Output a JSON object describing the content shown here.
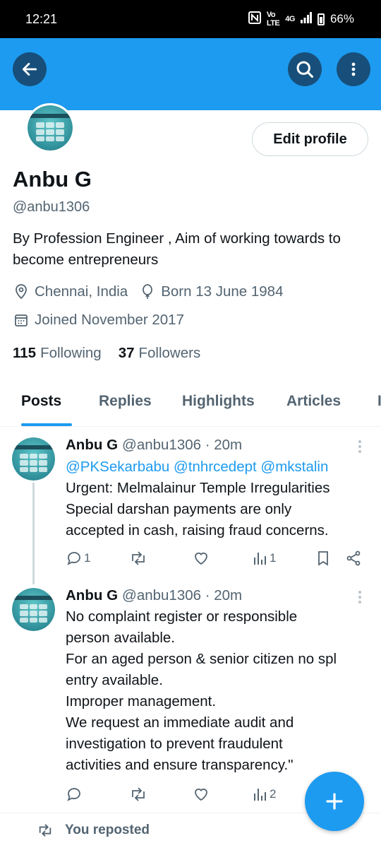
{
  "status_bar": {
    "time": "12:21",
    "network": "4G",
    "battery": "66%"
  },
  "header": {
    "back_icon": "arrow-left-icon",
    "search_icon": "search-icon",
    "more_icon": "more-vertical-icon",
    "banner_color": "#1d9bf0"
  },
  "profile": {
    "edit_button": "Edit profile",
    "name": "Anbu G",
    "handle": "@anbu1306",
    "bio": "By Profession Engineer , Aim of working towards to become entrepreneurs",
    "location": "Chennai, India",
    "birthday": "Born 13 June 1984",
    "joined": "Joined November 2017",
    "following_count": "115",
    "following_label": "Following",
    "followers_count": "37",
    "followers_label": "Followers"
  },
  "tabs": [
    {
      "label": "Posts",
      "active": true
    },
    {
      "label": "Replies",
      "active": false
    },
    {
      "label": "Highlights",
      "active": false
    },
    {
      "label": "Articles",
      "active": false
    },
    {
      "label": "I",
      "active": false
    }
  ],
  "posts": [
    {
      "author": "Anbu G",
      "handle_time": "@anbu1306 · 20m",
      "mentions": "@PKSekarbabu @tnhrcedept @mkstalin",
      "lines": [
        "Urgent: Melmalainur Temple Irregularities",
        "Special darshan payments are only",
        "accepted in cash, raising fraud concerns."
      ],
      "reply_count": "1",
      "views_count": "1"
    },
    {
      "author": "Anbu G",
      "handle_time": "@anbu1306 · 20m",
      "lines": [
        "No complaint register or responsible",
        "person available.",
        "For an aged person & senior citizen no spl",
        "entry available.",
        "Improper management.",
        "We request an immediate audit and",
        "investigation to prevent fraudulent",
        "activities and ensure transparency.\""
      ],
      "reply_count": "",
      "views_count": "2"
    }
  ],
  "repost_label": "You reposted",
  "accent_color": "#1d9bf0"
}
